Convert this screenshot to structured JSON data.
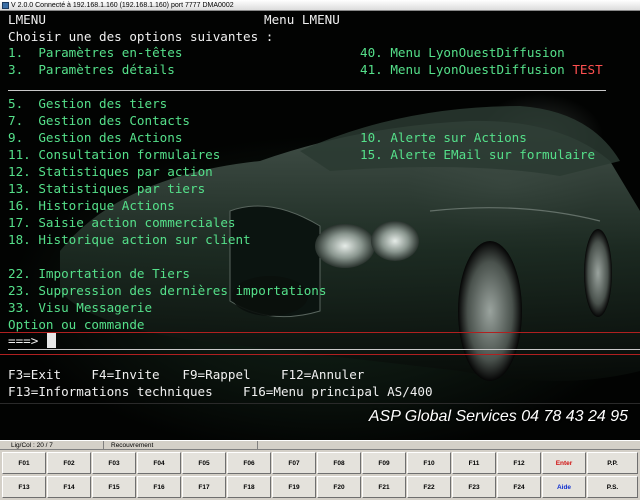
{
  "window": {
    "title": "V 2.0.0 Connecté à 192.168.1.160 (192.168.1.160) port 7777  DMA0002"
  },
  "screen": {
    "program_name": "LMENU",
    "header_title": "Menu LMENU",
    "prompt": "Choisir une des options suivantes :",
    "menu_left": [
      {
        "num": "1.",
        "label": "Paramètres en-têtes"
      },
      {
        "num": "3.",
        "label": "Paramètres détails"
      },
      {
        "num": "5.",
        "label": "Gestion des tiers"
      },
      {
        "num": "7.",
        "label": "Gestion des Contacts"
      },
      {
        "num": "9.",
        "label": "Gestion des Actions"
      },
      {
        "num": "11.",
        "label": "Consultation formulaires"
      },
      {
        "num": "12.",
        "label": "Statistiques par action"
      },
      {
        "num": "13.",
        "label": "Statistiques par tiers"
      },
      {
        "num": "16.",
        "label": "Historique Actions"
      },
      {
        "num": "17.",
        "label": "Saisie action commerciales"
      },
      {
        "num": "18.",
        "label": "Historique action sur client"
      },
      {
        "num": "22.",
        "label": "Importation de Tiers"
      },
      {
        "num": "23.",
        "label": "Suppression des dernières importations"
      },
      {
        "num": "33.",
        "label": "Visu Messagerie"
      }
    ],
    "menu_right": [
      {
        "num": "40.",
        "label": "Menu LyonOuestDiffusion",
        "suffix": ""
      },
      {
        "num": "41.",
        "label": "Menu LyonOuestDiffusion",
        "suffix": "TEST"
      },
      {
        "num": "10.",
        "label": "Alerte sur Actions",
        "suffix": ""
      },
      {
        "num": "15.",
        "label": "Alerte EMail sur formulaire",
        "suffix": ""
      }
    ],
    "command_label": "Option ou commande",
    "command_arrow": "===>",
    "command_value": "",
    "fkeys_line1": "F3=Exit    F4=Invite   F9=Rappel    F12=Annuler",
    "fkeys_line2": "F13=Informations techniques    F16=Menu principal AS/400",
    "brand": "ASP Global Services 04 78 43 24 95"
  },
  "statusbar": {
    "position": "Lig/Col : 20 / 7",
    "mode": "Recouvrement"
  },
  "function_keys": {
    "row1": [
      "F01",
      "F02",
      "F03",
      "F04",
      "F05",
      "F06",
      "F07",
      "F08",
      "F09",
      "F10",
      "F11",
      "F12",
      "Enter",
      "P.P."
    ],
    "row2": [
      "F13",
      "F14",
      "F15",
      "F16",
      "F17",
      "F18",
      "F19",
      "F20",
      "F21",
      "F22",
      "F23",
      "F24",
      "Aide",
      "P.S."
    ]
  },
  "colors": {
    "terminal_green": "#55e08a",
    "terminal_white": "#f0f0f0",
    "accent_red": "#ff5050",
    "separator_white": "#c8c8c8",
    "separator_red": "#b02020",
    "enter_key": "#d01010",
    "help_key": "#1030d0"
  }
}
